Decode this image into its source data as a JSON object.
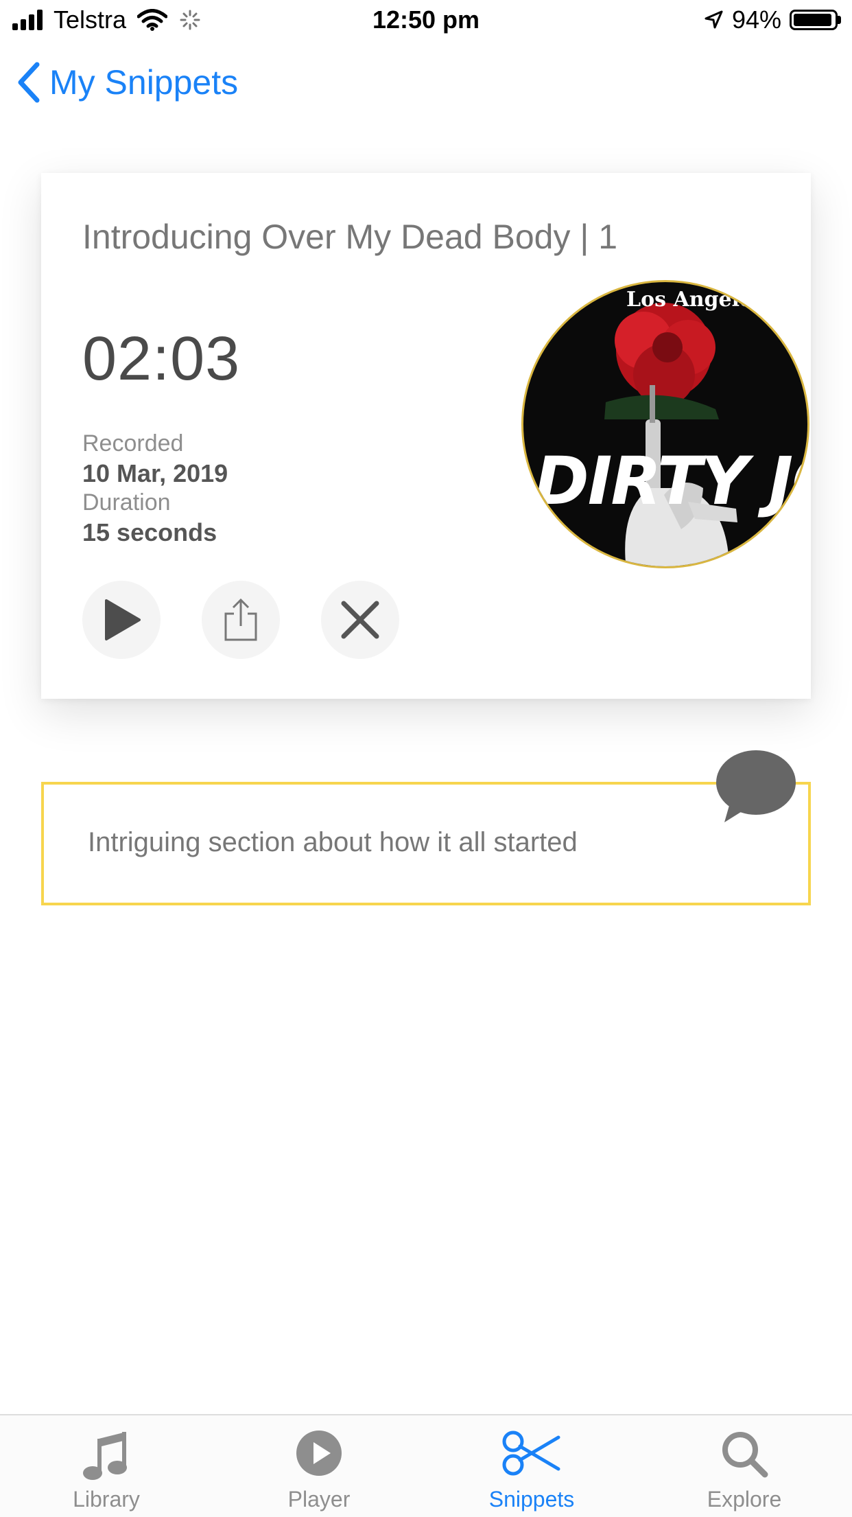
{
  "status": {
    "carrier": "Telstra",
    "time": "12:50 pm",
    "battery": "94%",
    "battery_level": 0.94,
    "icons": [
      "signal-bars-icon",
      "wifi-icon",
      "activity-spinner-icon",
      "location-arrow-icon",
      "battery-icon"
    ]
  },
  "nav": {
    "back_label": "My Snippets"
  },
  "snippet": {
    "title": "Introducing Over My Dead Body | 1",
    "time": "02:03",
    "recorded_label": "Recorded",
    "recorded_value": "10 Mar, 2019",
    "duration_label": "Duration",
    "duration_value": "15 seconds",
    "actions": [
      "play-icon",
      "share-icon",
      "close-icon"
    ],
    "artwork": {
      "header": "Los Angeles Times",
      "title": "DIRTY JOH"
    }
  },
  "note": {
    "text": "Intriguing section about how it all started",
    "border_color": "#f7d54e",
    "icon": "speech-bubble-icon"
  },
  "tabs": [
    {
      "label": "Library",
      "icon": "music-note-icon",
      "active": false
    },
    {
      "label": "Player",
      "icon": "play-circle-icon",
      "active": false
    },
    {
      "label": "Snippets",
      "icon": "scissors-icon",
      "active": true
    },
    {
      "label": "Explore",
      "icon": "search-icon",
      "active": false
    }
  ],
  "colors": {
    "accent": "#1a82f7",
    "inactive": "#8e8e8e"
  }
}
